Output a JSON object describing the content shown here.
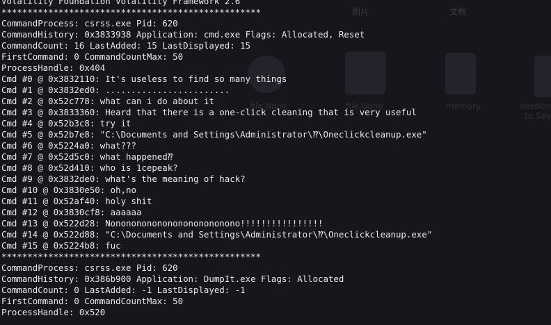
{
  "terminal": {
    "lines": [
      "Volatility Foundation Volatility Framework 2.6",
      "**************************************************",
      "CommandProcess: csrss.exe Pid: 620",
      "CommandHistory: 0x3833938 Application: cmd.exe Flags: Allocated, Reset",
      "CommandCount: 16 LastAdded: 15 LastDisplayed: 15",
      "FirstCommand: 0 CommandCountMax: 50",
      "ProcessHandle: 0x404",
      "Cmd #0 @ 0x3832110: It's useless to find so many things",
      "Cmd #1 @ 0x3832ed0: ........................",
      "Cmd #2 @ 0x52c778: what can i do about it",
      "Cmd #3 @ 0x3833360: Heard that there is a one-click cleaning that is very useful",
      "Cmd #4 @ 0x52b3c8: try it",
      "Cmd #5 @ 0x52b7e8: \"C:\\Documents and Settings\\Administrator\\⁇\\Oneclickcleanup.exe\"",
      "Cmd #6 @ 0x5224a0: what???",
      "Cmd #7 @ 0x52d5c0: what happened⁇",
      "Cmd #8 @ 0x52d410: who is 1cepeak?",
      "Cmd #9 @ 0x3832de0: what's the meaning of hack?",
      "Cmd #10 @ 0x3830e50: oh,no",
      "Cmd #11 @ 0x52af40: holy shit",
      "Cmd #12 @ 0x3830cf8: aaaaaa",
      "Cmd #13 @ 0x522d28: Nonononononononononononono!!!!!!!!!!!!!!!!",
      "Cmd #14 @ 0x522d88: \"C:\\Documents and Settings\\Administrator\\⁇\\Oneclickcleanup.exe\"",
      "Cmd #15 @ 0x5224b8: fuc",
      "**************************************************",
      "CommandProcess: csrss.exe Pid: 620",
      "CommandHistory: 0x386b900 Application: DumpIt.exe Flags: Allocated",
      "CommandCount: 0 LastAdded: -1 LastDisplayed: -1",
      "FirstCommand: 0 CommandCountMax: 50",
      "ProcessHandle: 0x520"
    ]
  },
  "background": {
    "tabs": [
      "图片",
      "文档"
    ],
    "items": [
      "file.None",
      "file.None",
      "memory",
      "sessions to.Sav"
    ]
  },
  "colors": {
    "background": "#16171c",
    "text": "#e9e9ec",
    "ghost": "#2e3038"
  }
}
